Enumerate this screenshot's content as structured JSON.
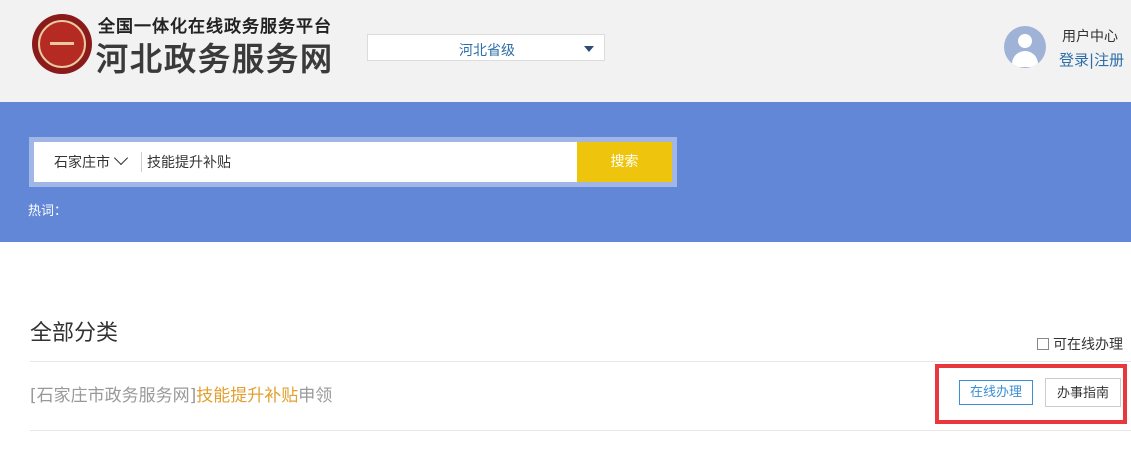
{
  "header": {
    "platform_title": "全国一体化在线政务服务平台",
    "site_title": "河北政务服务网",
    "region_select": {
      "value": "河北省级"
    },
    "user_center": "用户中心",
    "login": "登录",
    "separator": "|",
    "register": "注册"
  },
  "search": {
    "city": "石家庄市",
    "query": "技能提升补贴",
    "button_label": "搜索",
    "hotwords_label": "热词："
  },
  "results": {
    "section_title": "全部分类",
    "filter_label": "可在线办理",
    "items": [
      {
        "source": "[石家庄市政务服务网]",
        "keyword": "技能提升补贴",
        "suffix": "申领",
        "online_button": "在线办理",
        "guide_button": "办事指南"
      }
    ]
  },
  "colors": {
    "banner": "#6187d6",
    "search_button": "#efc40c",
    "link": "#2d6ea8",
    "keyword": "#e0a030",
    "highlight": "#e8383d"
  }
}
